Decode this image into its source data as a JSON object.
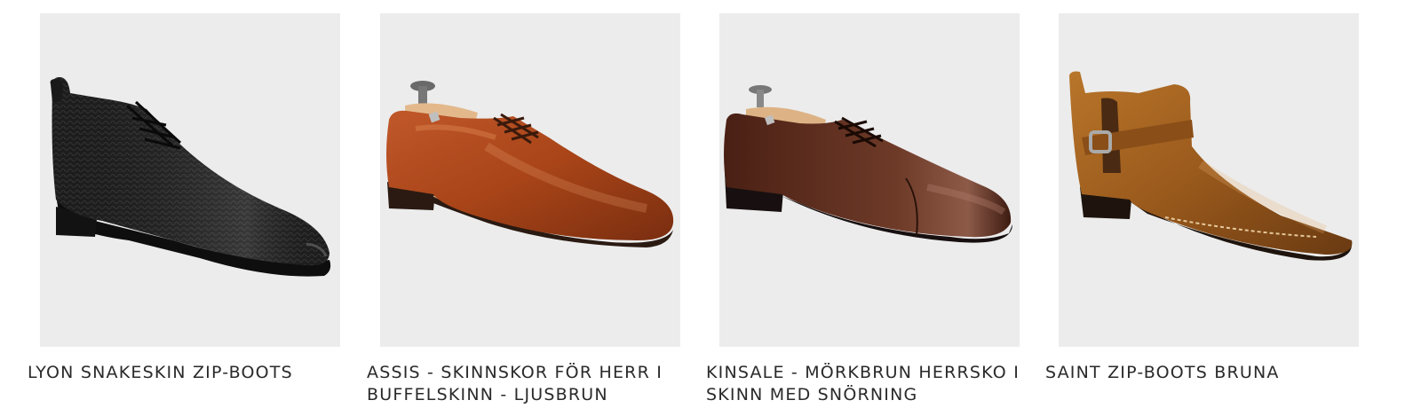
{
  "products": [
    {
      "title": "LYON SNAKESKIN ZIP-BOOTS",
      "image_icon": "black-snakeskin-chukka-boot-image",
      "colors": {
        "upper": "#1b1b1b",
        "highlight": "#4a4a4a",
        "sole": "#111111",
        "bg": "#ececec"
      }
    },
    {
      "title": "ASSIS - SKINNSKOR FÖR HERR I BUFFELSKINN - LJUSBRUN",
      "image_icon": "light-brown-derby-shoe-image",
      "colors": {
        "upper": "#a9471c",
        "highlight": "#d4784a",
        "sole": "#2a1a12",
        "bg": "#ececec"
      }
    },
    {
      "title": "KINSALE - MÖRKBRUN HERRSKO I SKINN MED SNÖRNING",
      "image_icon": "dark-brown-captoe-shoe-image",
      "colors": {
        "upper": "#5a2b1a",
        "highlight": "#8c5240",
        "sole": "#1a110c",
        "bg": "#ececec"
      }
    },
    {
      "title": "SAINT ZIP-BOOTS BRUNA",
      "image_icon": "tan-buckle-ankle-boot-image",
      "colors": {
        "upper": "#9a5a1c",
        "highlight": "#d39a55",
        "sole": "#1e140d",
        "bg": "#ececec"
      }
    }
  ]
}
